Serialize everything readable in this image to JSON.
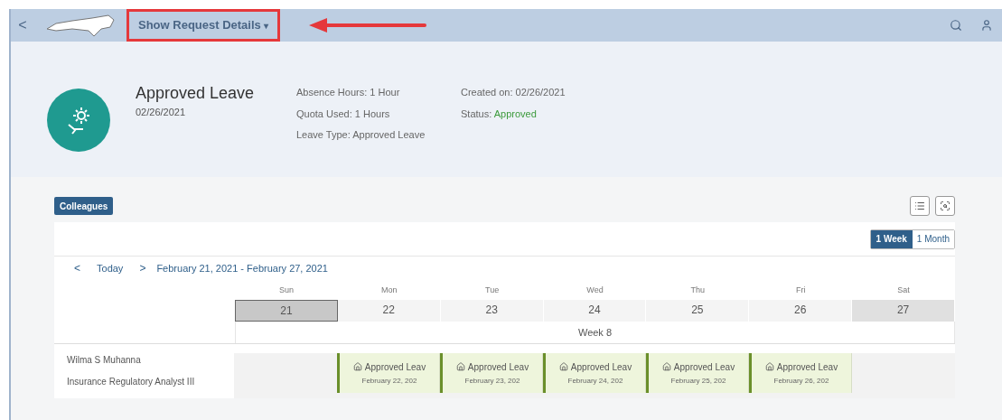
{
  "top_bar": {
    "back": "<",
    "menu_title": "Show Request Details",
    "menu_caret": "▾"
  },
  "header": {
    "title": "Approved Leave",
    "date": "02/26/2021",
    "details": [
      "Absence Hours: 1 Hour",
      "Quota Used: 1 Hours",
      "Leave Type: Approved Leave"
    ],
    "created": "Created on: 02/26/2021",
    "status_label": "Status:",
    "status": "Approved"
  },
  "colleagues_button": "Colleagues",
  "view_toggle": [
    {
      "label": "1 Week",
      "selected": true
    },
    {
      "label": "1 Month",
      "selected": false
    }
  ],
  "nav": {
    "prev": "<",
    "today": "Today",
    "next": ">",
    "range": "February 21, 2021 - February 27, 2021"
  },
  "days": [
    {
      "name": "Sun",
      "date": "21",
      "selected": true,
      "weekend": true
    },
    {
      "name": "Mon",
      "date": "22",
      "selected": false,
      "weekend": false
    },
    {
      "name": "Tue",
      "date": "23",
      "selected": false,
      "weekend": false
    },
    {
      "name": "Wed",
      "date": "24",
      "selected": false,
      "weekend": false
    },
    {
      "name": "Thu",
      "date": "25",
      "selected": false,
      "weekend": false
    },
    {
      "name": "Fri",
      "date": "26",
      "selected": false,
      "weekend": false
    },
    {
      "name": "Sat",
      "date": "27",
      "selected": false,
      "weekend": true
    }
  ],
  "week_label": "Week 8",
  "people": [
    {
      "name": "Wilma S Muhanna",
      "role": "Insurance Regulatory Analyst III",
      "entries": [
        {
          "kind": "empty"
        },
        {
          "kind": "leave",
          "title": "Approved Leav",
          "date": "February 22, 202"
        },
        {
          "kind": "leave",
          "title": "Approved Leav",
          "date": "February 23, 202"
        },
        {
          "kind": "leave",
          "title": "Approved Leav",
          "date": "February 24, 202"
        },
        {
          "kind": "leave",
          "title": "Approved Leav",
          "date": "February 25, 202"
        },
        {
          "kind": "leave",
          "title": "Approved Leav",
          "date": "February 26, 202"
        },
        {
          "kind": "empty"
        }
      ]
    }
  ]
}
